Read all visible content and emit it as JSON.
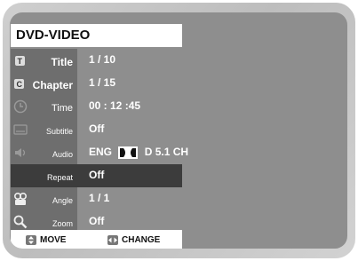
{
  "header": {
    "title": "DVD-VIDEO"
  },
  "rows": [
    {
      "label": "Title",
      "value": "1 / 10",
      "icon": "title-icon"
    },
    {
      "label": "Chapter",
      "value": "1 / 15",
      "icon": "chapter-icon"
    },
    {
      "label": "Time",
      "value": "00 : 12 :45",
      "icon": "clock-icon"
    },
    {
      "label": "Subtitle",
      "value": "Off",
      "icon": "subtitle-icon"
    },
    {
      "label": "Audio",
      "value_lang": "ENG",
      "value_format": "D 5.1 CH",
      "icon": "speaker-icon"
    },
    {
      "label": "Repeat",
      "value": "Off",
      "icon": "repeat-icon"
    },
    {
      "label": "Angle",
      "value": "1 / 1",
      "icon": "camera-icon"
    },
    {
      "label": "Zoom",
      "value": "Off",
      "icon": "zoom-icon"
    }
  ],
  "footer": {
    "move_label": "MOVE",
    "change_label": "CHANGE"
  },
  "colors": {
    "screen": "#8e8e8e",
    "label_column": "#6e6e6e",
    "selected_row": "#3c3c3c"
  },
  "selected_row": "Repeat"
}
